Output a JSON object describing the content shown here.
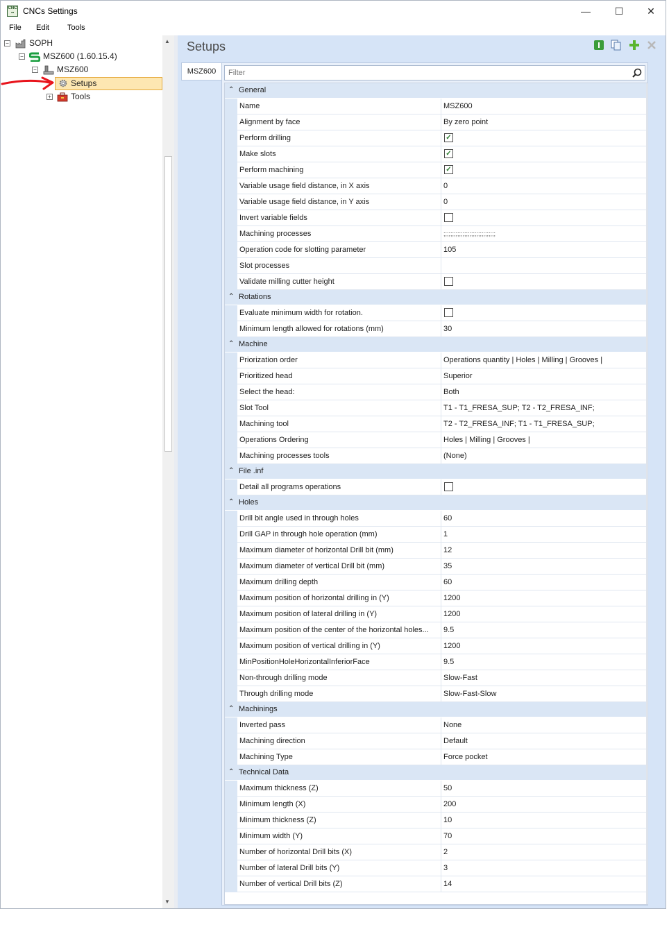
{
  "window": {
    "title": "CNCs Settings",
    "icon": "cnc-app-icon",
    "minimize": "—",
    "maximize": "☐",
    "close": "✕"
  },
  "menu": [
    "File",
    "Edit",
    "Tools"
  ],
  "tree": {
    "items": [
      {
        "label": "SOPH",
        "icon": "factory-icon",
        "toggle": "−"
      },
      {
        "label": "MSZ600 (1.60.15.4)",
        "icon": "s-logo-icon",
        "toggle": "−"
      },
      {
        "label": "MSZ600",
        "icon": "machine-icon",
        "toggle": "−"
      },
      {
        "label": "Setups",
        "icon": "gear-icon"
      },
      {
        "label": "Tools",
        "icon": "toolbox-icon",
        "toggle": "+"
      }
    ]
  },
  "panel": {
    "title": "Setups",
    "tab": "MSZ600",
    "filter_placeholder": "Filter"
  },
  "categories": [
    {
      "label": "General",
      "rows": [
        {
          "name": "Name",
          "value": "MSZ600"
        },
        {
          "name": "Alignment by face",
          "value": "By zero point"
        },
        {
          "name": "Perform drilling",
          "check": true
        },
        {
          "name": "Make slots",
          "check": true
        },
        {
          "name": "Perform machining",
          "check": true
        },
        {
          "name": "Variable usage field distance, in X axis",
          "value": "0"
        },
        {
          "name": "Variable usage field distance, in Y axis",
          "value": "0"
        },
        {
          "name": "Invert variable fields",
          "check": false
        },
        {
          "name": "Machining processes",
          "value": ";;;;;;;;;;;;;;;;;;;;;;;;;;;;;;"
        },
        {
          "name": "Operation code for slotting parameter",
          "value": "105"
        },
        {
          "name": "Slot processes",
          "value": ""
        },
        {
          "name": "Validate milling cutter height",
          "check": false
        }
      ]
    },
    {
      "label": "Rotations",
      "rows": [
        {
          "name": "Evaluate minimum width for rotation.",
          "check": false
        },
        {
          "name": "Minimum length allowed for rotations (mm)",
          "value": "30"
        }
      ]
    },
    {
      "label": "Machine",
      "rows": [
        {
          "name": "Priorization order",
          "value": "Operations quantity | Holes | Milling | Grooves |"
        },
        {
          "name": "Prioritized head",
          "value": "Superior"
        },
        {
          "name": "Select the head:",
          "value": "Both"
        },
        {
          "name": "Slot Tool",
          "value": "T1 - T1_FRESA_SUP; T2 - T2_FRESA_INF;"
        },
        {
          "name": "Machining tool",
          "value": "T2 - T2_FRESA_INF; T1 - T1_FRESA_SUP;"
        },
        {
          "name": "Operations Ordering",
          "value": "Holes | Milling | Grooves |"
        },
        {
          "name": "Machining processes tools",
          "value": "(None)"
        }
      ]
    },
    {
      "label": "File .inf",
      "rows": [
        {
          "name": "Detail all programs operations",
          "check": false
        }
      ]
    },
    {
      "label": "Holes",
      "rows": [
        {
          "name": "Drill bit angle used in through holes",
          "value": "60"
        },
        {
          "name": "Drill GAP in through hole operation (mm)",
          "value": "1"
        },
        {
          "name": "Maximum diameter of horizontal Drill bit (mm)",
          "value": "12"
        },
        {
          "name": "Maximum diameter of vertical Drill bit (mm)",
          "value": "35"
        },
        {
          "name": "Maximum drilling depth",
          "value": "60"
        },
        {
          "name": "Maximum position of horizontal drilling in (Y)",
          "value": "1200"
        },
        {
          "name": "Maximum position of lateral drilling in (Y)",
          "value": "1200"
        },
        {
          "name": "Maximum position of the center of the horizontal holes...",
          "value": "9.5"
        },
        {
          "name": "Maximum position of vertical drilling in (Y)",
          "value": "1200"
        },
        {
          "name": "MinPositionHoleHorizontalInferiorFace",
          "value": "9.5"
        },
        {
          "name": "Non-through drilling mode",
          "value": "Slow-Fast"
        },
        {
          "name": "Through drilling mode",
          "value": "Slow-Fast-Slow"
        }
      ]
    },
    {
      "label": "Machinings",
      "rows": [
        {
          "name": "Inverted pass",
          "value": "None"
        },
        {
          "name": "Machining direction",
          "value": "Default"
        },
        {
          "name": "Machining Type",
          "value": "Force pocket"
        }
      ]
    },
    {
      "label": "Technical Data",
      "rows": [
        {
          "name": "Maximum thickness (Z)",
          "value": "50"
        },
        {
          "name": "Minimum length (X)",
          "value": "200"
        },
        {
          "name": "Minimum thickness (Z)",
          "value": "10"
        },
        {
          "name": "Minimum width (Y)",
          "value": "70"
        },
        {
          "name": "Number of horizontal Drill bits (X)",
          "value": "2"
        },
        {
          "name": "Number of lateral Drill bits (Y)",
          "value": "3"
        },
        {
          "name": "Number of vertical Drill bits (Z)",
          "value": "14"
        }
      ]
    }
  ],
  "colors": {
    "accent": "#3a9d3a",
    "selected_bg": "#fde7b2",
    "category_bg": "#dae6f5",
    "annotation_arrow": "#e8141c"
  }
}
